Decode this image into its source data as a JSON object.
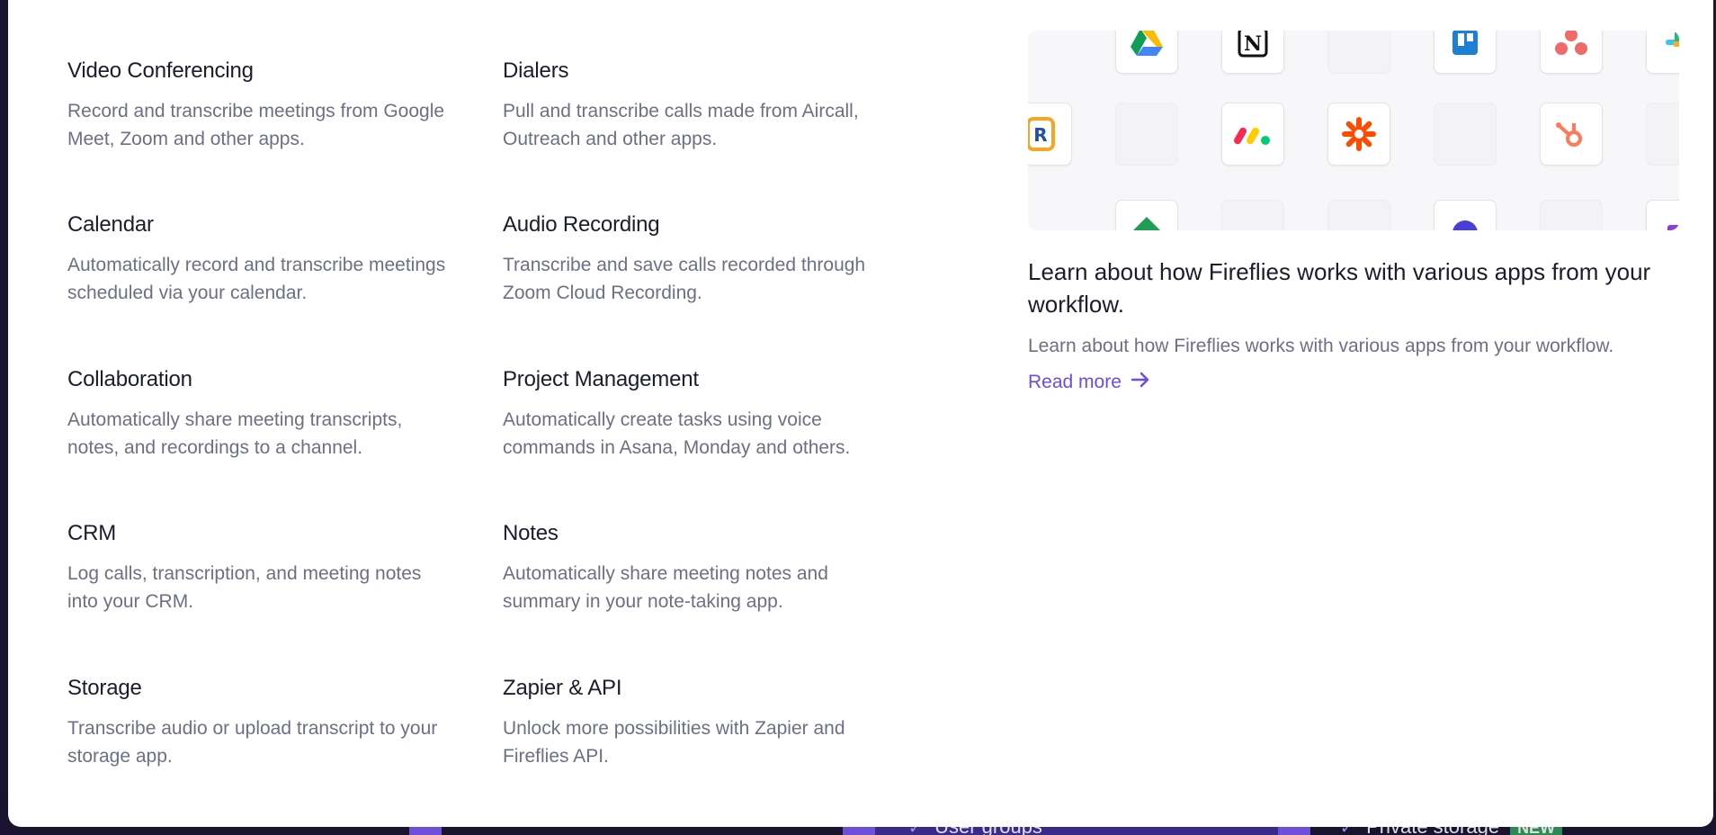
{
  "menu": {
    "items": [
      {
        "title": "Video Conferencing",
        "description": "Record and transcribe meetings from Google Meet, Zoom and other apps."
      },
      {
        "title": "Dialers",
        "description": "Pull and transcribe calls made from Aircall, Outreach and other apps."
      },
      {
        "title": "Calendar",
        "description": "Automatically record and transcribe meetings scheduled via your calendar."
      },
      {
        "title": "Audio Recording",
        "description": "Transcribe and save calls recorded through Zoom Cloud Recording."
      },
      {
        "title": "Collaboration",
        "description": "Automatically share meeting transcripts, notes, and recordings to a channel."
      },
      {
        "title": "Project Management",
        "description": "Automatically create tasks using voice commands in Asana, Monday and others."
      },
      {
        "title": "CRM",
        "description": "Log calls, transcription, and meeting notes into your CRM."
      },
      {
        "title": "Notes",
        "description": "Automatically share meeting notes and summary in your note-taking app."
      },
      {
        "title": "Storage",
        "description": "Transcribe audio or upload transcript to your storage app."
      },
      {
        "title": "Zapier & API",
        "description": "Unlock more possibilities with Zapier and Fireflies API."
      }
    ]
  },
  "feature": {
    "title": "Learn about how Fireflies works with various apps from your workflow.",
    "description": "Learn about how Fireflies works with various apps from your workflow.",
    "read_more_label": "Read more",
    "app_icons": [
      "google-drive",
      "notion",
      "blank",
      "trello",
      "asana",
      "slack",
      "rev",
      "blank",
      "monday",
      "zapier",
      "blank",
      "hubspot",
      "blank",
      "teams",
      "blank",
      "blank",
      "webex",
      "blank",
      "blank"
    ]
  },
  "background": {
    "user_groups_label": "User groups",
    "private_storage_label": "Private storage",
    "new_badge": "NEW"
  },
  "colors": {
    "accent": "#6c4ce6",
    "title_text": "#1a1d2b",
    "body_text": "#6b7086",
    "page_bg": "#1c1530"
  }
}
